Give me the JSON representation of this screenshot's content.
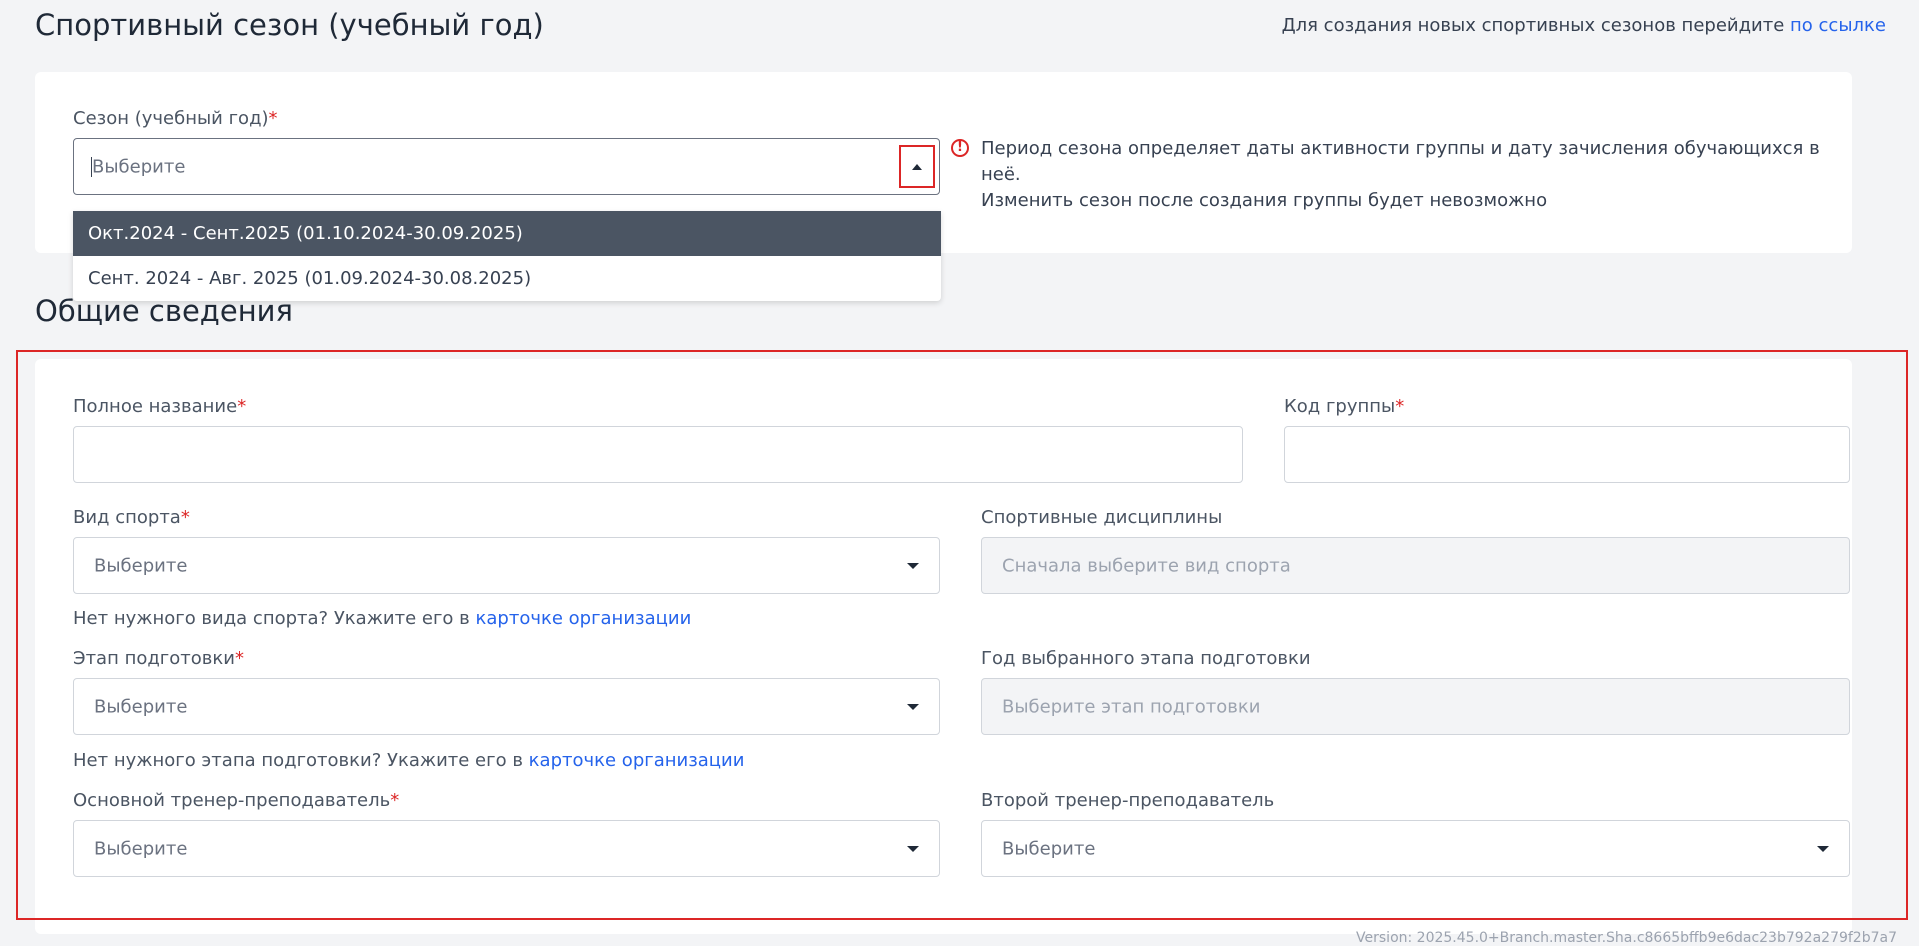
{
  "header": {
    "title": "Спортивный сезон (учебный год)",
    "hint_text": "Для создания новых спортивных сезонов перейдите",
    "hint_link": "по ссылке"
  },
  "season": {
    "label": "Сезон (учебный год)",
    "required_mark": "*",
    "placeholder": "Выберите",
    "note_line1": "Период сезона определяет даты активности группы и дату зачисления обучающихся в неё.",
    "note_line2": "Изменить сезон после создания группы будет невозможно",
    "options": [
      "Окт.2024 - Сент.2025 (01.10.2024-30.09.2025)",
      "Сент. 2024 - Авг. 2025 (01.09.2024-30.08.2025)"
    ]
  },
  "general": {
    "title": "Общие сведения",
    "full_name_label": "Полное название",
    "group_code_label": "Код группы",
    "sport_label": "Вид спорта",
    "sport_placeholder": "Выберите",
    "disciplines_label": "Спортивные дисциплины",
    "disciplines_placeholder": "Сначала выберите вид спорта",
    "sport_help_text": "Нет нужного вида спорта? Укажите его в",
    "sport_help_link": "карточке организации",
    "stage_label": "Этап подготовки",
    "stage_placeholder": "Выберите",
    "stage_year_label": "Год выбранного этапа подготовки",
    "stage_year_placeholder": "Выберите этап подготовки",
    "stage_help_text": "Нет нужного этапа подготовки? Укажите его в",
    "stage_help_link": "карточке организации",
    "main_coach_label": "Основной тренер-преподаватель",
    "main_coach_placeholder": "Выберите",
    "second_coach_label": "Второй тренер-преподаватель",
    "second_coach_placeholder": "Выберите",
    "required_mark": "*"
  },
  "footer": {
    "version": "Version: 2025.45.0+Branch.master.Sha.c8665bffb9e6dac23b792a279f2b7a7"
  },
  "colors": {
    "accent": "#2563eb",
    "required": "#dc2626",
    "highlight_frame": "#dc2626",
    "dropdown_active_bg": "#4b5563"
  },
  "icons": {
    "season_caret": "chevron-up-icon",
    "select_caret": "chevron-down-icon",
    "warning": "exclamation-circle-icon"
  }
}
